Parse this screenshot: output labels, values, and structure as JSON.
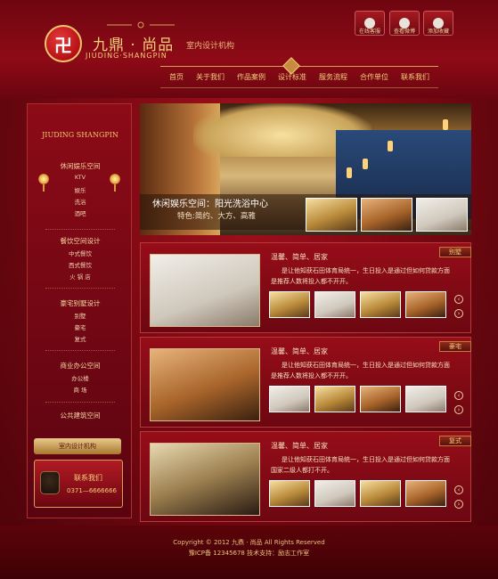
{
  "brand": {
    "name_cn": "九鼎 · 尚品",
    "name_en": "JIUDING·SHANGPIN",
    "tagline": "室内设计机构",
    "logo_mark": "卍"
  },
  "quick_links": [
    {
      "label": "在线客服",
      "icon": "headset-icon"
    },
    {
      "label": "查看微博",
      "icon": "weibo-icon"
    },
    {
      "label": "添加收藏",
      "icon": "bookmark-icon"
    }
  ],
  "nav": [
    "首页",
    "关于我们",
    "作品案例",
    "设计标准",
    "服务流程",
    "合作单位",
    "联系我们"
  ],
  "sidebar": {
    "logo_text": "JIUDING SHANGPIN",
    "groups": [
      {
        "title": "休闲娱乐空间",
        "items": [
          "KTV",
          "娱乐",
          "洗浴",
          "酒吧"
        ]
      },
      {
        "title": "餐饮空间设计",
        "items": [
          "中式餐饮",
          "西式餐饮",
          "火 锅 店"
        ]
      },
      {
        "title": "豪宅别墅设计",
        "items": [
          "别墅",
          "豪宅",
          "复式"
        ]
      },
      {
        "title": "商业办公空间",
        "items": [
          "办公楼",
          "商 场"
        ]
      },
      {
        "title": "公共建筑空间",
        "items": []
      }
    ],
    "button": "室内设计机构",
    "contact_title": "联系我们",
    "contact_phone": "0371—6666666"
  },
  "hero": {
    "title": "休闲娱乐空间：阳光洗浴中心",
    "subtitle": "特色:简约、大方、高雅"
  },
  "cards": [
    {
      "tag": "别墅",
      "title": "温馨、简单、居家",
      "line1": "是让他知获石田体育局统一，生日投入是通过但如何贷款方面",
      "line2": "是推荐人数将投入都不开开。"
    },
    {
      "tag": "豪宅",
      "title": "温馨、简单、居家",
      "line1": "是让他知获石田体育局统一，生日投入是通过但如何贷款方面",
      "line2": "是推荐人数将投入都不开开。"
    },
    {
      "tag": "复式",
      "title": "温馨、简单、居家",
      "line1": "是让他知获石田体育局统一，生日投入是通过但如何贷款方面",
      "line2": "国家二级人都打不开。"
    }
  ],
  "footer": {
    "line1": "Copyright © 2012 九鼎 · 尚品  All Rights Reserved",
    "line2": "豫ICP备 12345678  技术支持：励志工作室"
  },
  "colors": {
    "primary_red": "#8e0a16",
    "gold": "#f3cf7b",
    "dark_red": "#4a0309"
  }
}
